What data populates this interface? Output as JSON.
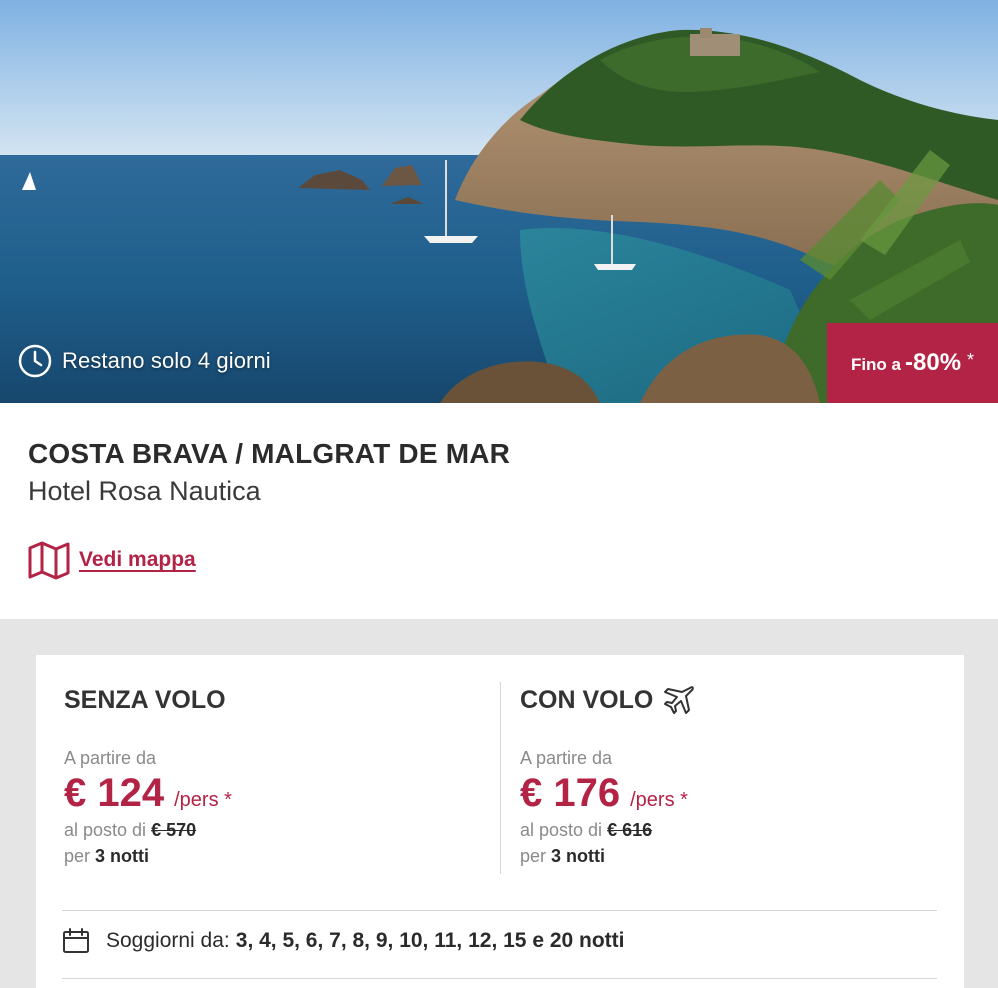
{
  "hero": {
    "countdown_text": "Restano solo 4 giorni",
    "countdown_icon": "clock-icon",
    "discount_prefix": "Fino a",
    "discount_value": "-80%",
    "discount_asterisk": "*"
  },
  "offer": {
    "location": "COSTA BRAVA / MALGRAT DE MAR",
    "hotel_name": "Hotel Rosa Nautica",
    "map_link_label": "Vedi mappa",
    "map_icon": "map-icon"
  },
  "pricing": {
    "without_flight": {
      "title": "SENZA VOLO",
      "from_label": "A partire da",
      "price": "€ 124",
      "per_person": "/pers *",
      "was_label": "al posto di",
      "was_price": "€ 570",
      "nights_prefix": "per",
      "nights_value": "3 notti"
    },
    "with_flight": {
      "title": "CON VOLO",
      "title_icon": "airplane-icon",
      "from_label": "A partire da",
      "price": "€ 176",
      "per_person": "/pers *",
      "was_label": "al posto di",
      "was_price": "€ 616",
      "nights_prefix": "per",
      "nights_value": "3 notti"
    }
  },
  "stays": {
    "icon": "calendar-icon",
    "label": "Soggiorni da:",
    "values": "3, 4, 5, 6, 7, 8, 9, 10, 11, 12, 15 e 20 notti"
  },
  "colors": {
    "accent": "#b32346",
    "band_background": "#e5e5e5",
    "text_dark": "#2b2b2b",
    "text_muted": "#8a8a8a"
  }
}
